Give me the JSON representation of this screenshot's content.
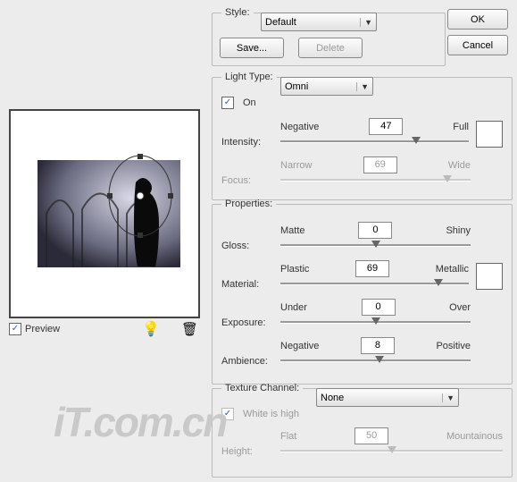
{
  "style": {
    "legend": "Style:",
    "selected": "Default",
    "save_label": "Save...",
    "delete_label": "Delete"
  },
  "buttons": {
    "ok": "OK",
    "cancel": "Cancel"
  },
  "light": {
    "legend": "Light Type:",
    "selected": "Omni",
    "on_label": "On",
    "intensity": {
      "label": "Intensity:",
      "left": "Negative",
      "right": "Full",
      "value": "47",
      "pos": 72
    },
    "focus": {
      "label": "Focus:",
      "left": "Narrow",
      "right": "Wide",
      "value": "69",
      "pos": 88
    }
  },
  "properties": {
    "legend": "Properties:",
    "gloss": {
      "label": "Gloss:",
      "left": "Matte",
      "right": "Shiny",
      "value": "0",
      "pos": 50
    },
    "material": {
      "label": "Material:",
      "left": "Plastic",
      "right": "Metallic",
      "value": "69",
      "pos": 84
    },
    "exposure": {
      "label": "Exposure:",
      "left": "Under",
      "right": "Over",
      "value": "0",
      "pos": 50
    },
    "ambience": {
      "label": "Ambience:",
      "left": "Negative",
      "right": "Positive",
      "value": "8",
      "pos": 52
    }
  },
  "texture": {
    "legend": "Texture Channel:",
    "selected": "None",
    "white_label": "White is high",
    "height": {
      "label": "Height:",
      "left": "Flat",
      "right": "Mountainous",
      "value": "50",
      "pos": 50
    }
  },
  "preview": {
    "label": "Preview"
  }
}
